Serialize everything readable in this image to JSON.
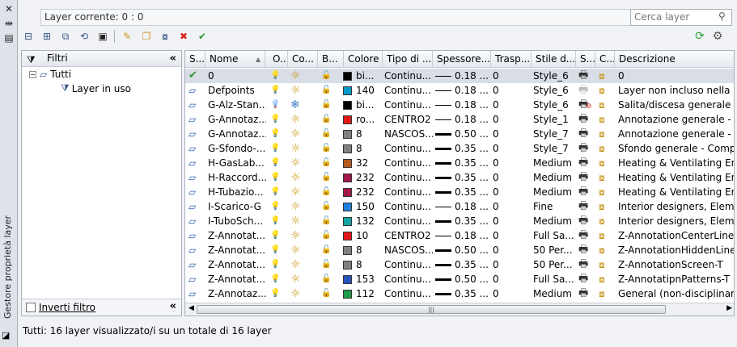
{
  "window": {
    "vertical_title": "Gestore proprietà layer",
    "close_glyph": "✕",
    "autohide_glyph": "⇹",
    "props_glyph": "▤"
  },
  "current_layer_label": "Layer corrente: 0 : 0",
  "search": {
    "placeholder": "Cerca layer",
    "icon": "search-icon"
  },
  "toolbar": [
    {
      "name": "new-properties-filter-button",
      "glyph": "⊟",
      "color": "#3a5a8a"
    },
    {
      "name": "new-group-filter-button",
      "glyph": "⊞",
      "color": "#3a5a8a"
    },
    {
      "name": "layer-states-manager-button",
      "glyph": "⧉",
      "color": "#3a5a8a"
    },
    {
      "name": "layer-states-restore-button",
      "glyph": "⟲",
      "color": "#3a5a8a"
    },
    {
      "name": "save-button",
      "glyph": "▣",
      "color": "#222"
    },
    {
      "name": "new-layer-button",
      "glyph": "✎",
      "color": "#c9941c"
    },
    {
      "name": "new-vp-frozen-layer-button",
      "glyph": "❐",
      "color": "#c9941c"
    },
    {
      "name": "new-layer-vp-button",
      "glyph": "⧇",
      "color": "#3a5a8a"
    },
    {
      "name": "delete-layer-button",
      "glyph": "✖",
      "color": "#d9261c"
    },
    {
      "name": "set-current-button",
      "glyph": "✔",
      "color": "#2e9b2e"
    }
  ],
  "toolbar_right": [
    {
      "name": "refresh-icon",
      "glyph": "⟳",
      "color": "#2e9b2e"
    },
    {
      "name": "settings-icon",
      "glyph": "⚙",
      "color": "#555"
    }
  ],
  "filters": {
    "title": "Filtri",
    "tree_root": "Tutti",
    "tree_child": "Layer in uso",
    "invert_label": "Inverti filtro",
    "invert_checked": false,
    "collapse_glyph": "«"
  },
  "columns": [
    {
      "label": "S..."
    },
    {
      "label": "Nome"
    },
    {
      "label": "O..."
    },
    {
      "label": "Co..."
    },
    {
      "label": "B..."
    },
    {
      "label": "Colore"
    },
    {
      "label": "Tipo di ..."
    },
    {
      "label": "Spessore..."
    },
    {
      "label": "Trasp..."
    },
    {
      "label": "Stile d..."
    },
    {
      "label": "S..."
    },
    {
      "label": "C..."
    },
    {
      "label": "Descrizione"
    }
  ],
  "rows": [
    {
      "status": "current",
      "name": "0",
      "color_name": "bi...",
      "swatch": "#000000",
      "linetype": "Continu...",
      "lw": "0.18 ...",
      "thick": false,
      "tr": "0",
      "style": "Style_6",
      "plot": "on",
      "desc": "0",
      "frozen": false,
      "on": true
    },
    {
      "status": "layer",
      "name": "Defpoints",
      "color_name": "140",
      "swatch": "#0099cc",
      "linetype": "Continu...",
      "lw": "0.18 ...",
      "thick": false,
      "tr": "0",
      "style": "Style_6",
      "plot": "dim",
      "desc": "Layer non incluso nella stam",
      "frozen": false,
      "on": true
    },
    {
      "status": "layer",
      "name": "G-Alz-Stan...",
      "color_name": "bi...",
      "swatch": "#000000",
      "linetype": "Continu...",
      "lw": "0.18 ...",
      "thick": false,
      "tr": "0",
      "style": "Style_6",
      "plot": "no",
      "desc": "Salita/discesa generale - Li",
      "frozen": true,
      "on": true
    },
    {
      "status": "layer",
      "name": "G-Annotaz...",
      "color_name": "ro...",
      "swatch": "#e01818",
      "linetype": "CENTRO2",
      "lw": "0.18 ...",
      "thick": false,
      "tr": "0",
      "style": "Style_1",
      "plot": "on",
      "desc": "Annotazione generale - Cor",
      "frozen": false,
      "on": true
    },
    {
      "status": "layer",
      "name": "G-Annotaz...",
      "color_name": "8",
      "swatch": "#808080",
      "linetype": "NASCOS...",
      "lw": "0.50 ...",
      "thick": true,
      "tr": "0",
      "style": "Style_7",
      "plot": "on",
      "desc": "Annotazione generale - Cor",
      "frozen": false,
      "on": true
    },
    {
      "status": "layer",
      "name": "G-Sfondo-...",
      "color_name": "8",
      "swatch": "#808080",
      "linetype": "Continu...",
      "lw": "0.35 ...",
      "thick": true,
      "tr": "0",
      "style": "Style_7",
      "plot": "on",
      "desc": "Sfondo generale - Compon",
      "frozen": false,
      "on": true
    },
    {
      "status": "layer",
      "name": "H-GasLab...",
      "color_name": "32",
      "swatch": "#b35a1c",
      "linetype": "Continu...",
      "lw": "0.35 ...",
      "thick": true,
      "tr": "0",
      "style": "Medium",
      "plot": "on",
      "desc": "Heating & Ventilating Engi",
      "frozen": false,
      "on": true
    },
    {
      "status": "layer",
      "name": "H-Raccord...",
      "color_name": "232",
      "swatch": "#a3174b",
      "linetype": "Continu...",
      "lw": "0.35 ...",
      "thick": true,
      "tr": "0",
      "style": "Medium",
      "plot": "on",
      "desc": "Heating & Ventilating Engi",
      "frozen": false,
      "on": true
    },
    {
      "status": "layer",
      "name": "H-Tubazio...",
      "color_name": "232",
      "swatch": "#a3174b",
      "linetype": "Continu...",
      "lw": "0.35 ...",
      "thick": true,
      "tr": "0",
      "style": "Medium",
      "plot": "on",
      "desc": "Heating & Ventilating Engi",
      "frozen": false,
      "on": true
    },
    {
      "status": "layer",
      "name": "I-Scarico-G",
      "color_name": "150",
      "swatch": "#1e7fdc",
      "linetype": "Continu...",
      "lw": "0.18 ...",
      "thick": false,
      "tr": "0",
      "style": "Fine",
      "plot": "on",
      "desc": "Interior designers, Element",
      "frozen": false,
      "on": true
    },
    {
      "status": "layer",
      "name": "I-TuboSch...",
      "color_name": "132",
      "swatch": "#14a3a3",
      "linetype": "Continu...",
      "lw": "0.35 ...",
      "thick": true,
      "tr": "0",
      "style": "Medium",
      "plot": "on",
      "desc": "Interior designers, Element",
      "frozen": false,
      "on": true
    },
    {
      "status": "layer",
      "name": "Z-Annotat...",
      "color_name": "10",
      "swatch": "#e01818",
      "linetype": "CENTRO2",
      "lw": "0.18 ...",
      "thick": false,
      "tr": "0",
      "style": "Full Sa...",
      "plot": "on",
      "desc": "Z-AnnotationCenterLines-T",
      "frozen": false,
      "on": true
    },
    {
      "status": "layer",
      "name": "Z-Annotat...",
      "color_name": "8",
      "swatch": "#808080",
      "linetype": "NASCOS...",
      "lw": "0.50 ...",
      "thick": true,
      "tr": "0",
      "style": "50 Per...",
      "plot": "on",
      "desc": "Z-AnnotationHiddenLines-T",
      "frozen": false,
      "on": true
    },
    {
      "status": "layer",
      "name": "Z-Annotat...",
      "color_name": "8",
      "swatch": "#808080",
      "linetype": "Continu...",
      "lw": "0.35 ...",
      "thick": true,
      "tr": "0",
      "style": "50 Per...",
      "plot": "on",
      "desc": "Z-AnnotationScreen-T",
      "frozen": false,
      "on": true
    },
    {
      "status": "layer",
      "name": "Z-Annotat...",
      "color_name": "153",
      "swatch": "#2a52be",
      "linetype": "Continu...",
      "lw": "0.50 ...",
      "thick": true,
      "tr": "0",
      "style": "Full Sa...",
      "plot": "on",
      "desc": "Z-AnnotatipnPatterns-T",
      "frozen": false,
      "on": true
    },
    {
      "status": "layer",
      "name": "Z-Annotaz...",
      "color_name": "112",
      "swatch": "#1e9c4a",
      "linetype": "Continu...",
      "lw": "0.35 ...",
      "thick": true,
      "tr": "0",
      "style": "Medium",
      "plot": "on",
      "desc": "General (non-disciplinary),",
      "frozen": false,
      "on": true
    }
  ],
  "scrollbar_grip": "|||",
  "status_text": "Tutti: 16 layer visualizzato/i su un totale di 16 layer"
}
